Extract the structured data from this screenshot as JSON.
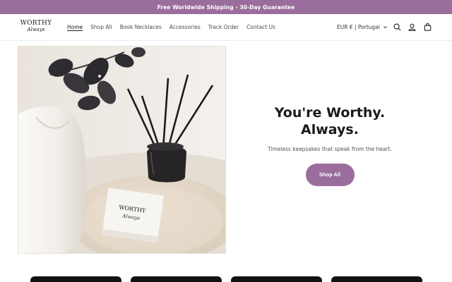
{
  "announcement": "Free Worldwide Shipping - 30-Day Guarantee",
  "logo": {
    "line1": "WORTHY",
    "line2": "Always"
  },
  "nav": [
    {
      "label": "Home",
      "active": true
    },
    {
      "label": "Shop All",
      "active": false
    },
    {
      "label": "Book Necklaces",
      "active": false
    },
    {
      "label": "Accessories",
      "active": false
    },
    {
      "label": "Track Order",
      "active": false
    },
    {
      "label": "Contact Us",
      "active": false
    }
  ],
  "locale": "EUR € | Portugal",
  "header_icons": [
    "search-icon",
    "account-icon",
    "cart-icon"
  ],
  "hero": {
    "title_line1": "You're Worthy.",
    "title_line2": "Always.",
    "subtitle": "Timeless keepsakes that speak from the heart.",
    "button_label": "Shop All",
    "box_text_line1": "WORTHY",
    "box_text_line2": "Always"
  },
  "colors": {
    "accent": "#9a6d9c",
    "announcement_bg": "#9a6d9c",
    "text": "#1a1a1a",
    "card": "#111111"
  }
}
